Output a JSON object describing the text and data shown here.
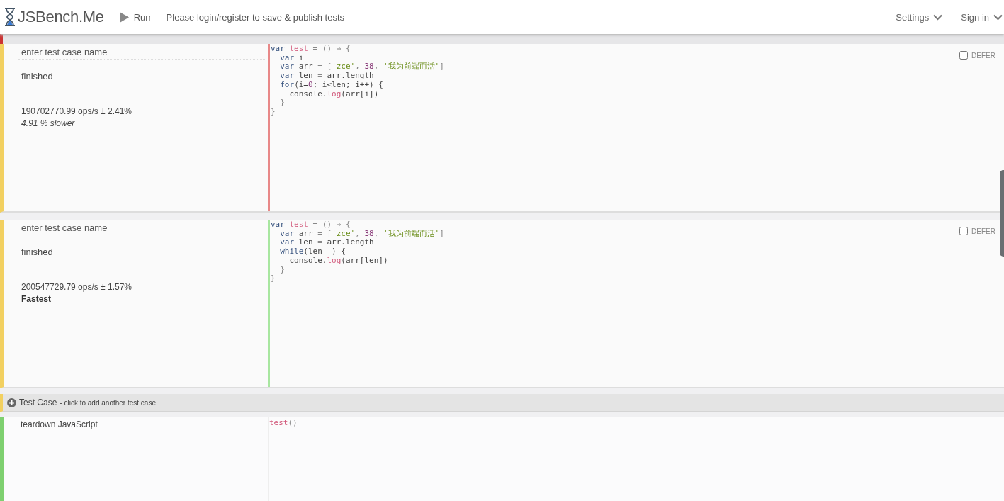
{
  "header": {
    "logo": "JSBench.Me",
    "run": "Run",
    "notice": "Please login/register to save & publish tests",
    "menus": [
      "Settings",
      "Sign in"
    ]
  },
  "test_cases": [
    {
      "name_placeholder": "enter test case name",
      "status": "finished",
      "ops": "190702770.99 ops/s ± 2.41%",
      "result": {
        "text": "4.91 % slower",
        "kind": "slower"
      },
      "defer": {
        "label": "DEFER",
        "checked": false
      },
      "code": [
        [
          {
            "text": "var",
            "kind": "kw"
          },
          {
            "text": " test",
            "kind": "def"
          },
          {
            "text": " = () ⇒ {",
            "kind": "p"
          }
        ],
        [
          {
            "text": "  var",
            "kind": "kw"
          },
          {
            "text": " i",
            "kind": "v"
          }
        ],
        [
          {
            "text": "  var",
            "kind": "kw"
          },
          {
            "text": " arr ",
            "kind": "v"
          },
          {
            "text": "= [",
            "kind": "p"
          },
          {
            "text": "'zce'",
            "kind": "str"
          },
          {
            "text": ", ",
            "kind": "p"
          },
          {
            "text": "38",
            "kind": "num"
          },
          {
            "text": ", ",
            "kind": "p"
          },
          {
            "text": "'我为前端而活'",
            "kind": "str"
          },
          {
            "text": "]",
            "kind": "p"
          }
        ],
        [
          {
            "text": "  var",
            "kind": "kw"
          },
          {
            "text": " len ",
            "kind": "v"
          },
          {
            "text": "= ",
            "kind": "p"
          },
          {
            "text": "arr.length",
            "kind": "v"
          }
        ],
        [
          {
            "text": "  for",
            "kind": "kw"
          },
          {
            "text": "(i=",
            "kind": "v"
          },
          {
            "text": "0",
            "kind": "num"
          },
          {
            "text": "; i<len; i++) {",
            "kind": "v"
          }
        ],
        [
          {
            "text": "    console.",
            "kind": "v"
          },
          {
            "text": "log",
            "kind": "def"
          },
          {
            "text": "(arr[i])",
            "kind": "v"
          }
        ],
        [
          {
            "text": "  }",
            "kind": "p"
          }
        ],
        [
          {
            "text": "}",
            "kind": "p"
          }
        ]
      ]
    },
    {
      "name_placeholder": "enter test case name",
      "status": "finished",
      "ops": "200547729.79 ops/s ± 1.57%",
      "result": {
        "text": "Fastest",
        "kind": "fastest"
      },
      "defer": {
        "label": "DEFER",
        "checked": false
      },
      "code": [
        [
          {
            "text": "var",
            "kind": "kw"
          },
          {
            "text": " test",
            "kind": "def"
          },
          {
            "text": " = () ⇒ {",
            "kind": "p"
          }
        ],
        [
          {
            "text": "  var",
            "kind": "kw"
          },
          {
            "text": " arr ",
            "kind": "v"
          },
          {
            "text": "= [",
            "kind": "p"
          },
          {
            "text": "'zce'",
            "kind": "str"
          },
          {
            "text": ", ",
            "kind": "p"
          },
          {
            "text": "38",
            "kind": "num"
          },
          {
            "text": ", ",
            "kind": "p"
          },
          {
            "text": "'我为前端而活'",
            "kind": "str"
          },
          {
            "text": "]",
            "kind": "p"
          }
        ],
        [
          {
            "text": "  var",
            "kind": "kw"
          },
          {
            "text": " len ",
            "kind": "v"
          },
          {
            "text": "= ",
            "kind": "p"
          },
          {
            "text": "arr.length",
            "kind": "v"
          }
        ],
        [
          {
            "text": "  while",
            "kind": "kw"
          },
          {
            "text": "(len--) {",
            "kind": "v"
          }
        ],
        [
          {
            "text": "    console.",
            "kind": "v"
          },
          {
            "text": "log",
            "kind": "def"
          },
          {
            "text": "(arr[len])",
            "kind": "v"
          }
        ],
        [
          {
            "text": "  }",
            "kind": "p"
          }
        ],
        [
          {
            "text": "}",
            "kind": "p"
          }
        ]
      ]
    }
  ],
  "add_case": {
    "title": "Test Case",
    "hint": "- click to add another test case"
  },
  "teardown": {
    "label": "teardown JavaScript",
    "code": [
      [
        {
          "text": "test",
          "kind": "def"
        },
        {
          "text": "()",
          "kind": "p"
        }
      ]
    ]
  }
}
